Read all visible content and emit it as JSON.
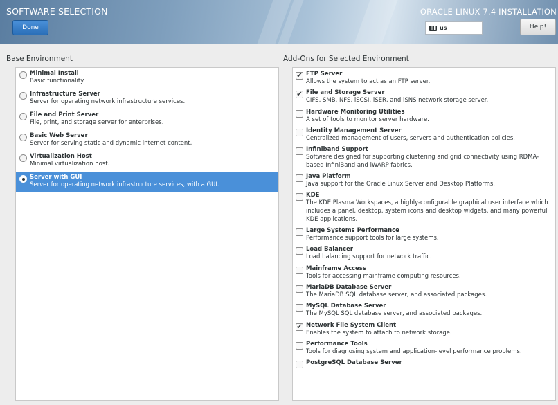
{
  "header": {
    "title": "SOFTWARE SELECTION",
    "done_label": "Done",
    "installer_title": "ORACLE LINUX 7.4 INSTALLATION",
    "keyboard_layout": "us",
    "help_label": "Help!"
  },
  "base_environment": {
    "heading": "Base Environment",
    "items": [
      {
        "title": "Minimal Install",
        "desc": "Basic functionality.",
        "selected": false
      },
      {
        "title": "Infrastructure Server",
        "desc": "Server for operating network infrastructure services.",
        "selected": false
      },
      {
        "title": "File and Print Server",
        "desc": "File, print, and storage server for enterprises.",
        "selected": false
      },
      {
        "title": "Basic Web Server",
        "desc": "Server for serving static and dynamic internet content.",
        "selected": false
      },
      {
        "title": "Virtualization Host",
        "desc": "Minimal virtualization host.",
        "selected": false
      },
      {
        "title": "Server with GUI",
        "desc": "Server for operating network infrastructure services, with a GUI.",
        "selected": true
      }
    ]
  },
  "addons": {
    "heading": "Add-Ons for Selected Environment",
    "items": [
      {
        "title": "FTP Server",
        "desc": "Allows the system to act as an FTP server.",
        "checked": true
      },
      {
        "title": "File and Storage Server",
        "desc": "CIFS, SMB, NFS, iSCSI, iSER, and iSNS network storage server.",
        "checked": true
      },
      {
        "title": "Hardware Monitoring Utilities",
        "desc": "A set of tools to monitor server hardware.",
        "checked": false
      },
      {
        "title": "Identity Management Server",
        "desc": "Centralized management of users, servers and authentication policies.",
        "checked": false
      },
      {
        "title": "Infiniband Support",
        "desc": "Software designed for supporting clustering and grid connectivity using RDMA-based InfiniBand and iWARP fabrics.",
        "checked": false
      },
      {
        "title": "Java Platform",
        "desc": "Java support for the Oracle Linux Server and Desktop Platforms.",
        "checked": false
      },
      {
        "title": "KDE",
        "desc": "The KDE Plasma Workspaces, a highly-configurable graphical user interface which includes a panel, desktop, system icons and desktop widgets, and many powerful KDE applications.",
        "checked": false
      },
      {
        "title": "Large Systems Performance",
        "desc": "Performance support tools for large systems.",
        "checked": false
      },
      {
        "title": "Load Balancer",
        "desc": "Load balancing support for network traffic.",
        "checked": false
      },
      {
        "title": "Mainframe Access",
        "desc": "Tools for accessing mainframe computing resources.",
        "checked": false
      },
      {
        "title": "MariaDB Database Server",
        "desc": "The MariaDB SQL database server, and associated packages.",
        "checked": false
      },
      {
        "title": "MySQL Database Server",
        "desc": "The MySQL SQL database server, and associated packages.",
        "checked": false
      },
      {
        "title": "Network File System Client",
        "desc": "Enables the system to attach to network storage.",
        "checked": true
      },
      {
        "title": "Performance Tools",
        "desc": "Tools for diagnosing system and application-level performance problems.",
        "checked": false
      },
      {
        "title": "PostgreSQL Database Server",
        "desc": "",
        "checked": false
      }
    ]
  }
}
